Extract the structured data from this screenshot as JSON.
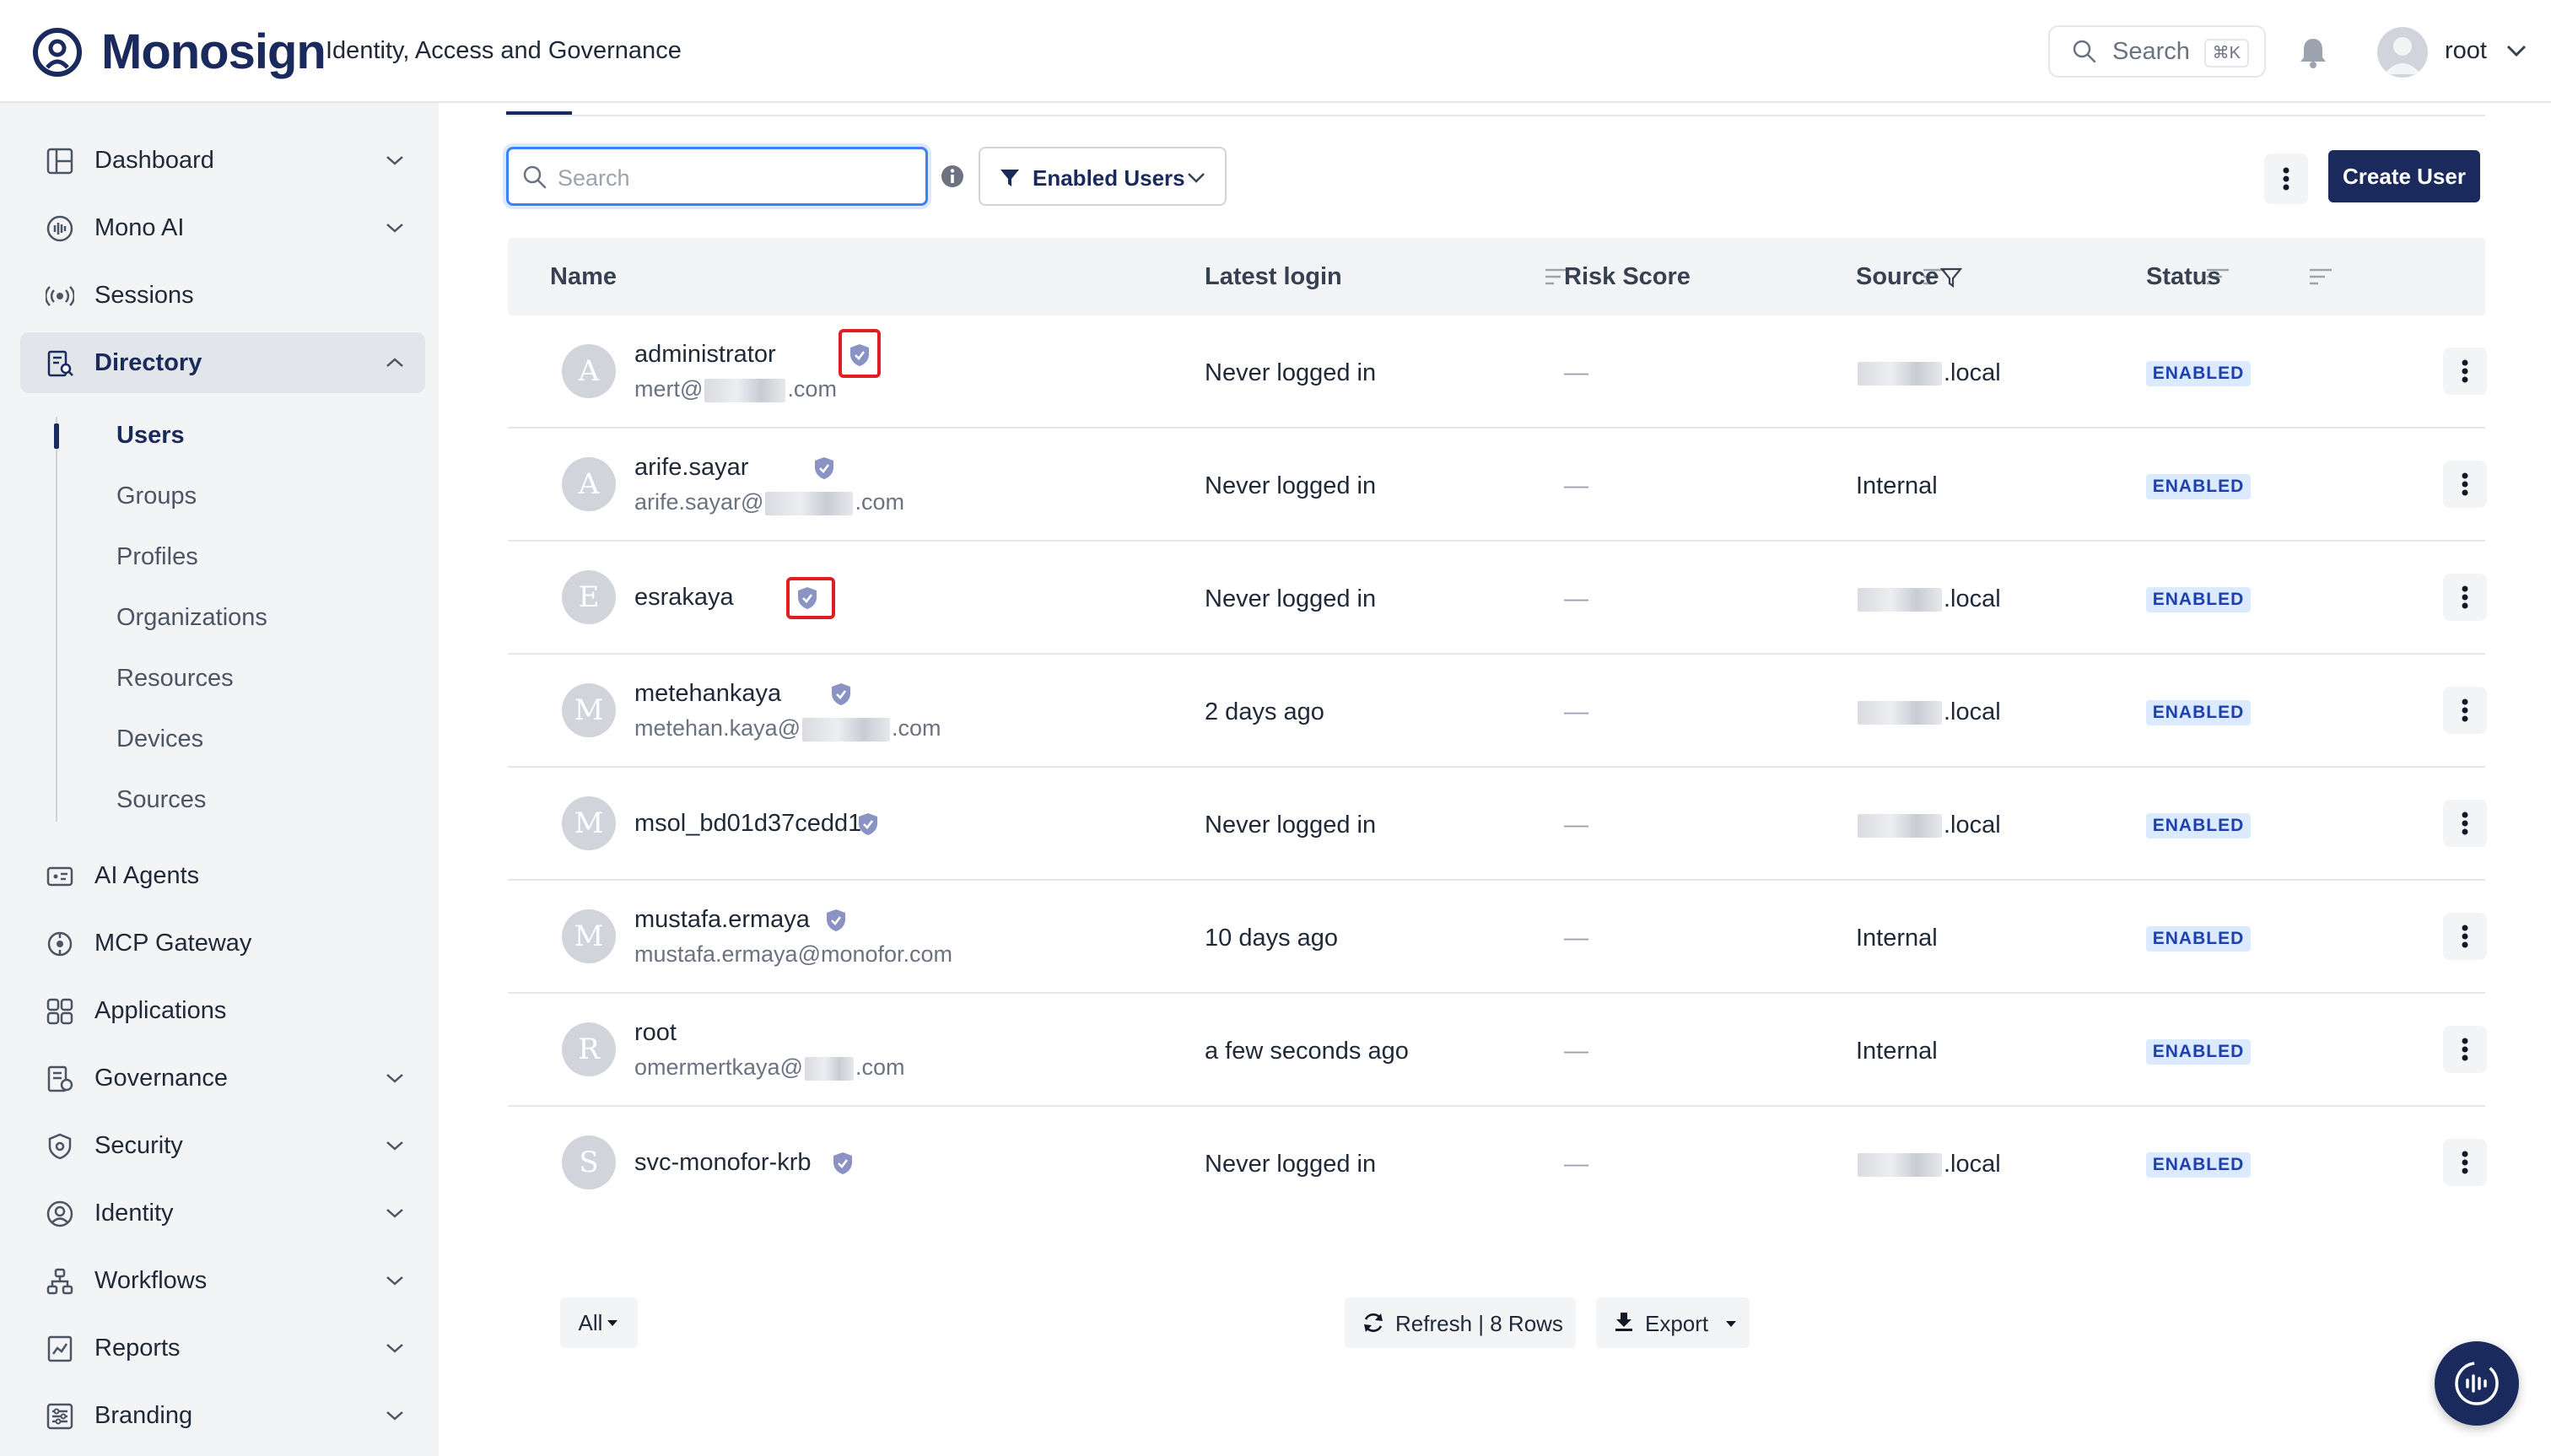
{
  "brand": {
    "name": "Monosign",
    "subtitle": "Identity, Access and Governance"
  },
  "header": {
    "search_label": "Search",
    "search_shortcut": "⌘K",
    "user_name": "root"
  },
  "sidebar": {
    "items": [
      {
        "label": "Dashboard",
        "icon": "dashboard-icon"
      },
      {
        "label": "Mono AI",
        "icon": "mono-ai-icon"
      },
      {
        "label": "Sessions",
        "icon": "sessions-icon"
      },
      {
        "label": "Directory",
        "icon": "directory-icon"
      },
      {
        "label": "AI Agents",
        "icon": "ai-agents-icon"
      },
      {
        "label": "MCP Gateway",
        "icon": "mcp-gateway-icon"
      },
      {
        "label": "Applications",
        "icon": "applications-icon"
      },
      {
        "label": "Governance",
        "icon": "governance-icon"
      },
      {
        "label": "Security",
        "icon": "security-icon"
      },
      {
        "label": "Identity",
        "icon": "identity-icon"
      },
      {
        "label": "Workflows",
        "icon": "workflows-icon"
      },
      {
        "label": "Reports",
        "icon": "reports-icon"
      },
      {
        "label": "Branding",
        "icon": "branding-icon"
      }
    ],
    "directory_sub": [
      "Users",
      "Groups",
      "Profiles",
      "Organizations",
      "Resources",
      "Devices",
      "Sources"
    ]
  },
  "toolbar": {
    "search_placeholder": "Search",
    "filter_label": "Enabled Users",
    "create_user_label": "Create User"
  },
  "table": {
    "headers": {
      "name": "Name",
      "latest_login": "Latest login",
      "risk_score": "Risk Score",
      "source": "Source",
      "status": "Status"
    },
    "rows": [
      {
        "initial": "A",
        "name": "administrator",
        "email_pre": "mert@",
        "email_post": ".com",
        "login": "Never logged in",
        "risk": "—",
        "source_post": ".local",
        "status": "ENABLED"
      },
      {
        "initial": "A",
        "name": "arife.sayar",
        "email_pre": "arife.sayar@",
        "email_post": ".com",
        "login": "Never logged in",
        "risk": "—",
        "source": "Internal",
        "status": "ENABLED"
      },
      {
        "initial": "E",
        "name": "esrakaya",
        "login": "Never logged in",
        "risk": "—",
        "source_post": ".local",
        "status": "ENABLED"
      },
      {
        "initial": "M",
        "name": "metehankaya",
        "email_pre": "metehan.kaya@",
        "email_post": ".com",
        "login": "2 days ago",
        "risk": "—",
        "source_post": ".local",
        "status": "ENABLED"
      },
      {
        "initial": "M",
        "name": "msol_bd01d37cedd1",
        "login": "Never logged in",
        "risk": "—",
        "source_post": ".local",
        "status": "ENABLED"
      },
      {
        "initial": "M",
        "name": "mustafa.ermaya",
        "email": "mustafa.ermaya@monofor.com",
        "login": "10 days ago",
        "risk": "—",
        "source": "Internal",
        "status": "ENABLED"
      },
      {
        "initial": "R",
        "name": "root",
        "email_pre": "omermertkaya@",
        "email_post": ".com",
        "login": "a few seconds ago",
        "risk": "—",
        "source": "Internal",
        "status": "ENABLED"
      },
      {
        "initial": "S",
        "name": "svc-monofor-krb",
        "login": "Never logged in",
        "risk": "—",
        "source_post": ".local",
        "status": "ENABLED"
      }
    ]
  },
  "footer": {
    "page_size_label": "All",
    "refresh_label": "Refresh | 8 Rows",
    "export_label": "Export"
  },
  "colors": {
    "brand_navy": "#1b2a5c",
    "badge_bg": "#dbeafe",
    "highlight_red": "#e11d24"
  }
}
